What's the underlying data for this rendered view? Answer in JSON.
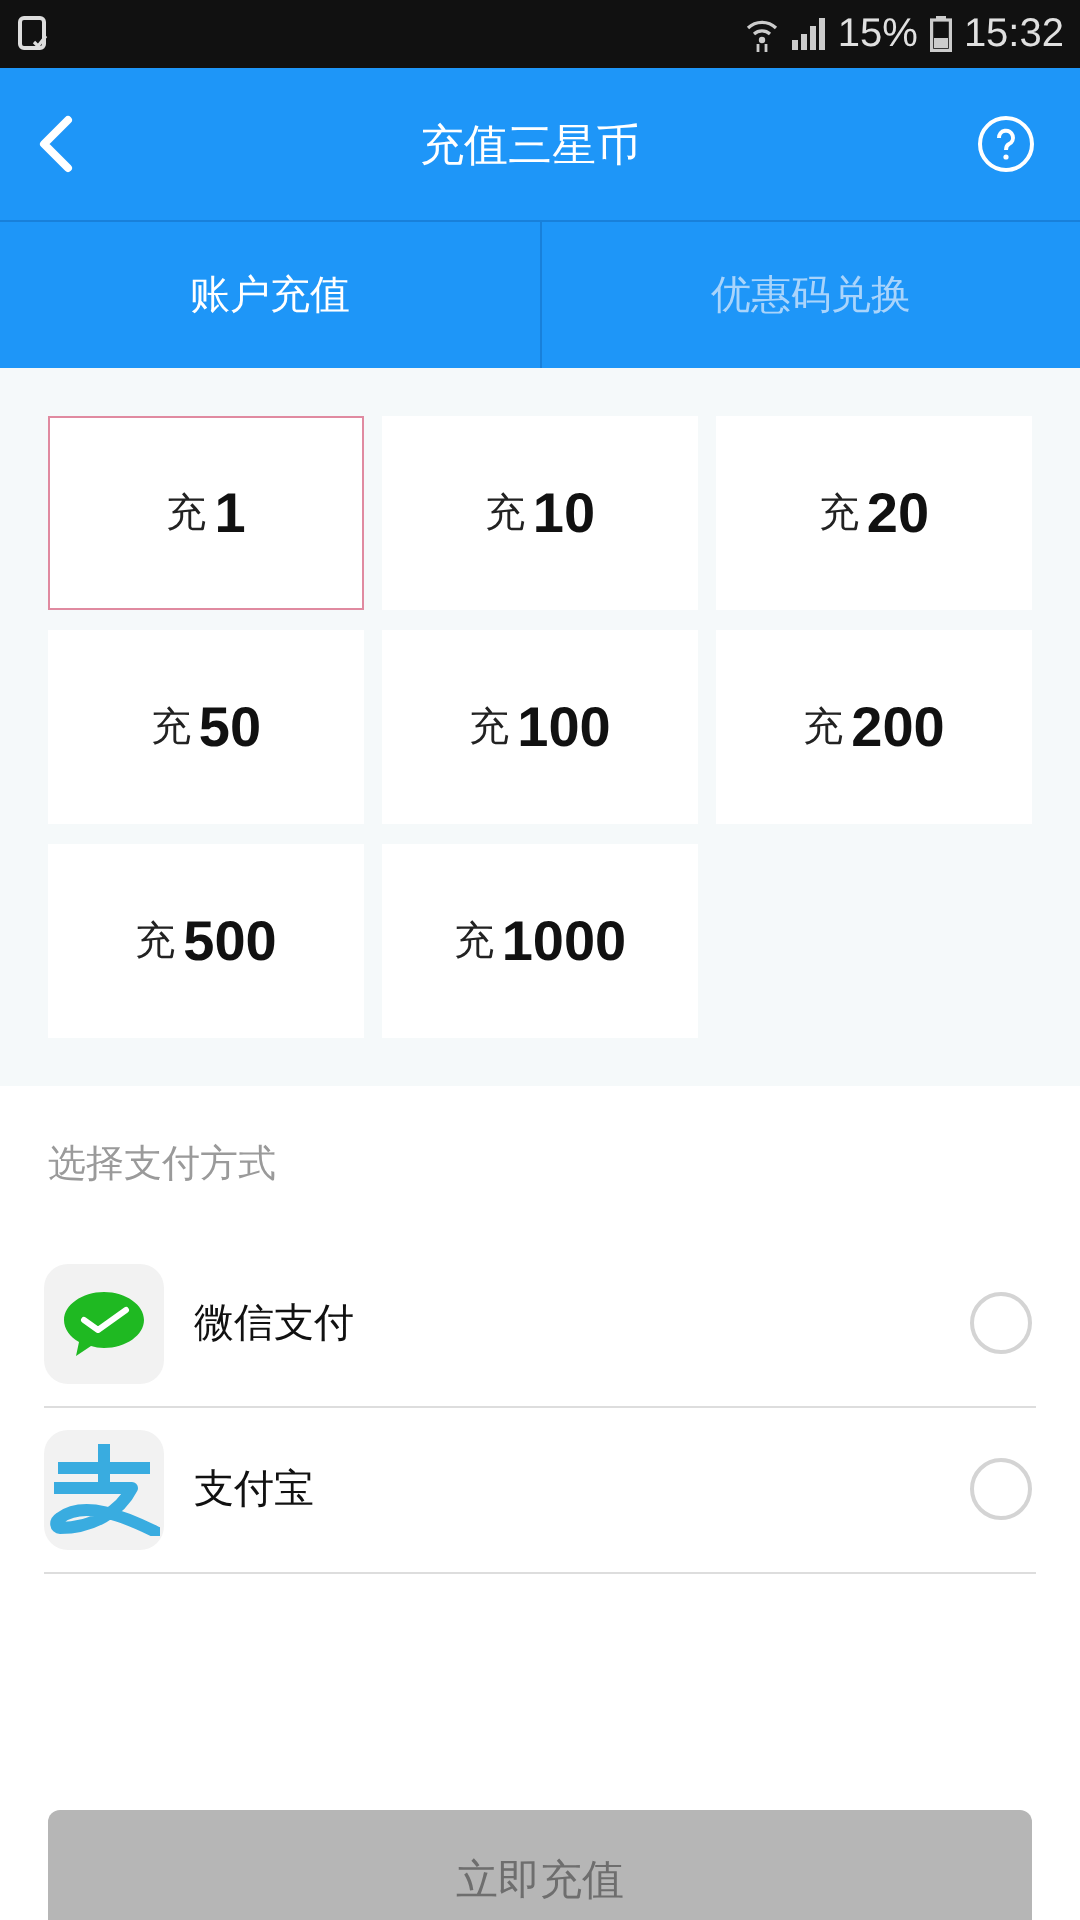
{
  "status_bar": {
    "battery": "15%",
    "time": "15:32"
  },
  "header": {
    "title": "充值三星币"
  },
  "tabs": [
    {
      "label": "账户充值",
      "selected": true
    },
    {
      "label": "优惠码兑换",
      "selected": false
    }
  ],
  "amounts": [
    {
      "prefix": "充",
      "amount": "1",
      "selected": true
    },
    {
      "prefix": "充",
      "amount": "10",
      "selected": false
    },
    {
      "prefix": "充",
      "amount": "20",
      "selected": false
    },
    {
      "prefix": "充",
      "amount": "50",
      "selected": false
    },
    {
      "prefix": "充",
      "amount": "100",
      "selected": false
    },
    {
      "prefix": "充",
      "amount": "200",
      "selected": false
    },
    {
      "prefix": "充",
      "amount": "500",
      "selected": false
    },
    {
      "prefix": "充",
      "amount": "1000",
      "selected": false
    }
  ],
  "payment": {
    "heading": "选择支付方式",
    "methods": [
      {
        "kind": "wechat",
        "label": "微信支付",
        "checked": false
      },
      {
        "kind": "alipay",
        "label": "支付宝",
        "checked": false
      }
    ]
  },
  "submit": {
    "label": "立即充值",
    "disabled": true
  }
}
